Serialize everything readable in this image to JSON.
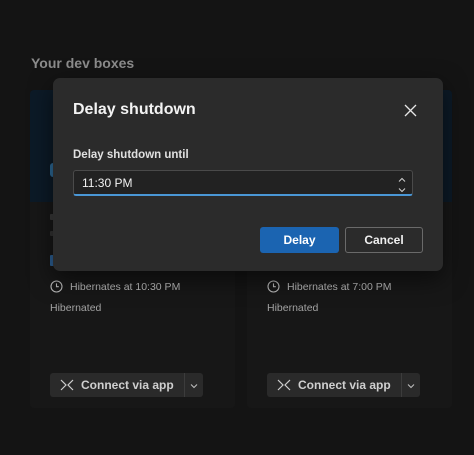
{
  "page": {
    "section_title": "Your dev boxes"
  },
  "cards": [
    {
      "status_text": "Hibernates at 10:30 PM",
      "state": "Hibernated",
      "connect_label": "Connect via app"
    },
    {
      "status_text": "Hibernates at 7:00 PM",
      "state": "Hibernated",
      "connect_label": "Connect via app"
    }
  ],
  "dialog": {
    "title": "Delay shutdown",
    "field_label": "Delay shutdown until",
    "time_value": "11:30 PM",
    "primary_label": "Delay",
    "secondary_label": "Cancel"
  },
  "icons": {
    "close": "close-icon",
    "clock": "clock-icon",
    "connect": "connect-icon",
    "chevron": "chevron-down-icon",
    "spin_up": "chevron-up-icon",
    "spin_down": "chevron-down-icon"
  },
  "colors": {
    "accent": "#1b64b1",
    "input_focus": "#4a97d6",
    "dialog_bg": "#2b2b2b",
    "page_bg": "#141414"
  }
}
